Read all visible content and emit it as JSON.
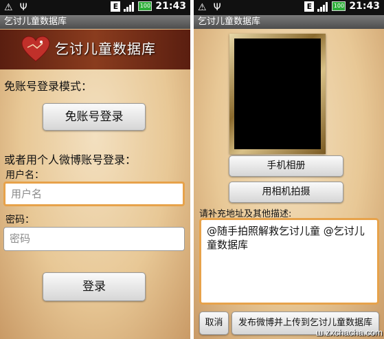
{
  "status": {
    "time": "21:43",
    "network": "E",
    "battery": "100"
  },
  "left": {
    "title": "乞讨儿童数据库",
    "banner_title": "乞讨儿童数据库",
    "no_account_heading": "免账号登录模式：",
    "no_account_button": "免账号登录",
    "weibo_heading": "或者用个人微博账号登录：",
    "username_label": "用户名：",
    "username_placeholder": "用户名",
    "password_label": "密码：",
    "password_placeholder": "密码",
    "login_button": "登录"
  },
  "right": {
    "title": "乞讨儿童数据库",
    "album_button": "手机相册",
    "camera_button": "用相机拍摄",
    "desc_label": "请补充地址及其他描述:",
    "desc_text": "@随手拍照解救乞讨儿童 @乞讨儿童数据库",
    "cancel_button": "取消",
    "publish_button": "发布微博并上传到乞讨儿童数据库"
  },
  "watermark": "ш.zxchacha.com",
  "colors": {
    "accent_border": "#e7a24a",
    "titlebar": "#5e5e5e",
    "banner": "#6e2a16"
  }
}
